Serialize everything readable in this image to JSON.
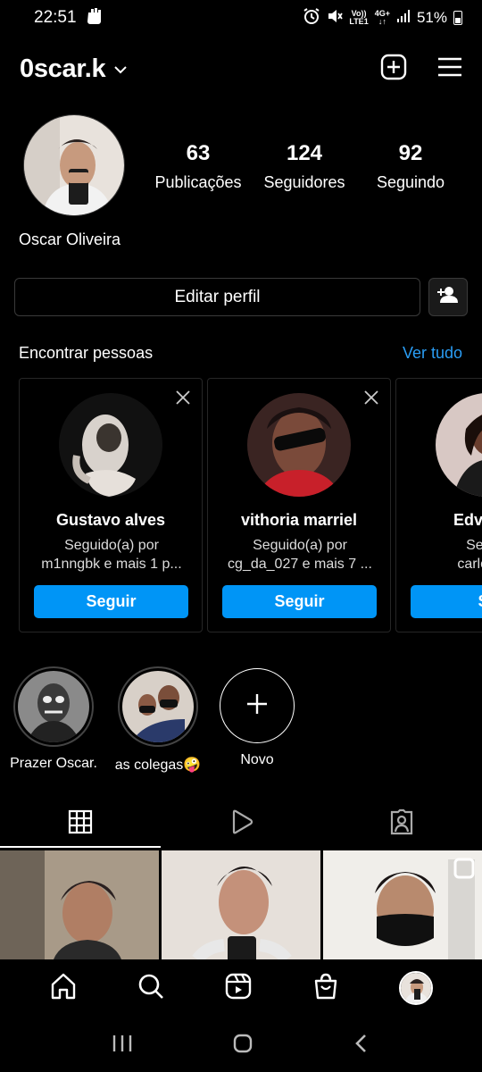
{
  "status_bar": {
    "time": "22:51",
    "network_top": "Vo))",
    "network_bottom": "LTE1",
    "net_gen": "4G+",
    "battery": "51%"
  },
  "header": {
    "username": "0scar.k"
  },
  "profile": {
    "stats": [
      {
        "value": "63",
        "label": "Publicações"
      },
      {
        "value": "124",
        "label": "Seguidores"
      },
      {
        "value": "92",
        "label": "Seguindo"
      }
    ],
    "display_name": "Oscar Oliveira",
    "edit_label": "Editar perfil"
  },
  "discover": {
    "title": "Encontrar pessoas",
    "see_all": "Ver tudo",
    "cards": [
      {
        "name": "Gustavo alves",
        "line1": "Seguido(a) por",
        "line2": "m1nngbk e mais 1 p...",
        "button": "Seguir"
      },
      {
        "name": "vithoria marriel",
        "line1": "Seguido(a) por",
        "line2": "cg_da_027 e mais 7 ...",
        "button": "Seguir"
      },
      {
        "name": "Edvando",
        "line1": "Seguid",
        "line2": "carloshen",
        "button": "Se"
      }
    ]
  },
  "highlights": [
    {
      "label": "Prazer Oscar."
    },
    {
      "label": "as colegas🤪"
    },
    {
      "label": "Novo"
    }
  ],
  "colors": {
    "accent_blue": "#0095f6",
    "link_blue": "#2a9df4",
    "background": "#000000"
  }
}
